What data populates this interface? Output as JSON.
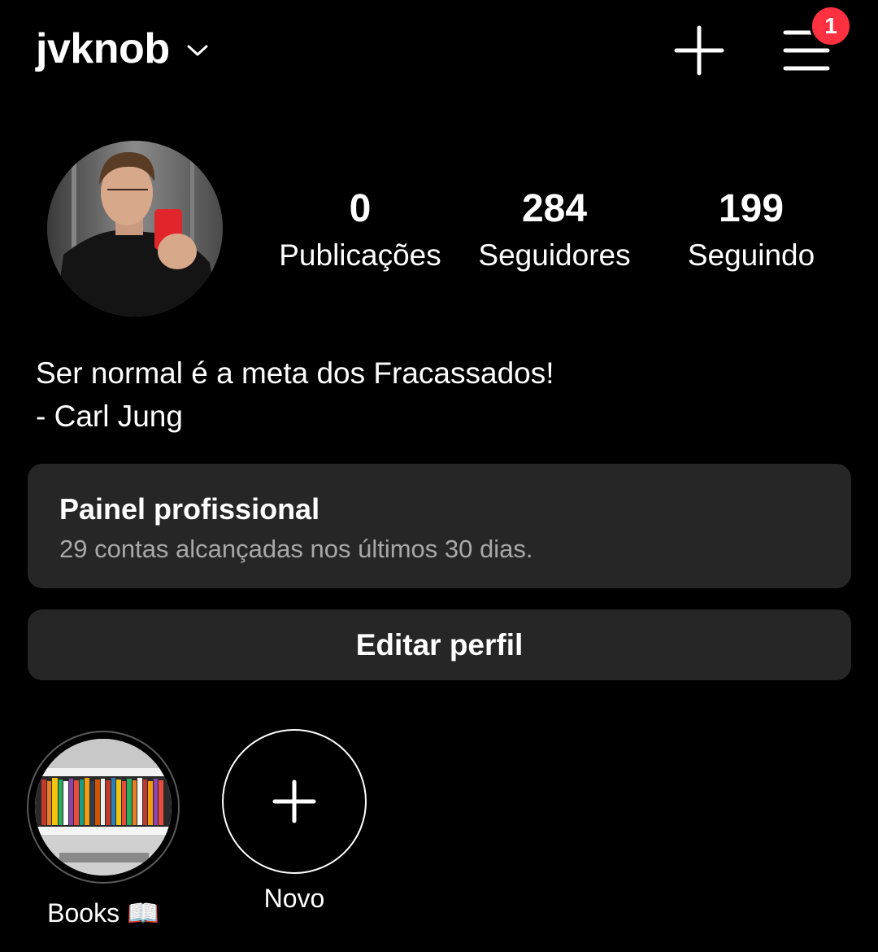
{
  "header": {
    "username": "jvknob",
    "notification_count": "1",
    "badge_color": "#ff3040",
    "icons": [
      "chevron-down-icon",
      "plus-icon",
      "hamburger-menu-icon"
    ]
  },
  "profile": {
    "stats": [
      {
        "value": "0",
        "label": "Publicações"
      },
      {
        "value": "284",
        "label": "Seguidores"
      },
      {
        "value": "199",
        "label": "Seguindo"
      }
    ],
    "bio_line1": "Ser normal é a meta dos Fracassados!",
    "bio_line2": "- Carl Jung"
  },
  "professional_dashboard": {
    "title": "Painel profissional",
    "subtitle": "29 contas alcançadas nos últimos 30 dias."
  },
  "edit_profile_label": "Editar perfil",
  "highlights": [
    {
      "label": "Books 📖"
    },
    {
      "label": "Novo"
    }
  ],
  "colors": {
    "background": "#000000",
    "card": "#262626",
    "secondary_text": "#a8a8a8"
  }
}
